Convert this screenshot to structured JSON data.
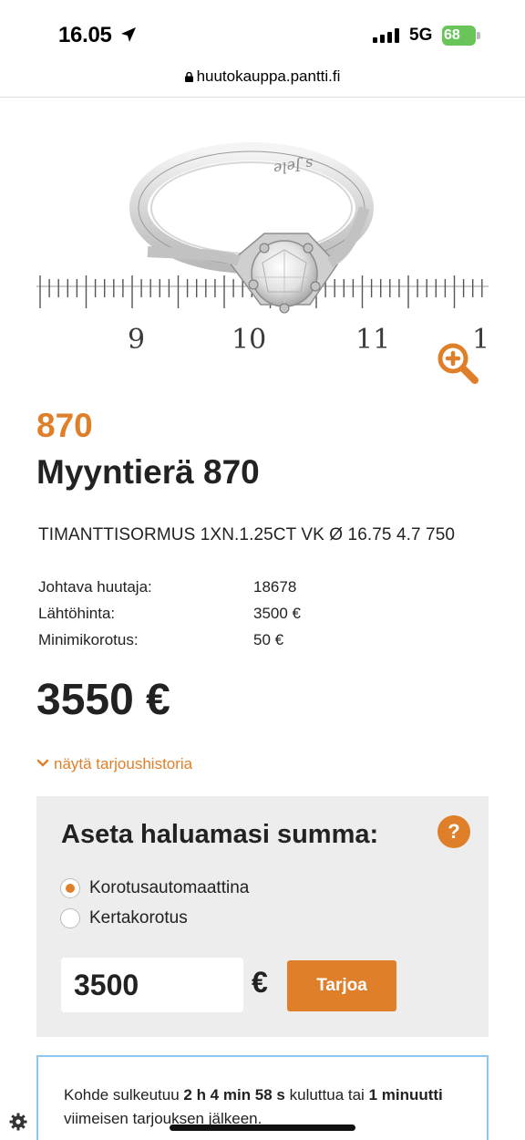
{
  "status_bar": {
    "time": "16.05",
    "network": "5G",
    "battery": "68"
  },
  "browser": {
    "url": "huutokauppa.pantti.fi"
  },
  "lot": {
    "number": "870",
    "title": "Myyntierä 870",
    "description": "TIMANTTISORMUS 1XN.1.25CT VK Ø 16.75 4.7 750",
    "ruler_labels": [
      "9",
      "10",
      "11",
      "1"
    ],
    "ring_engraving": "s Jele",
    "details": [
      {
        "label": "Johtava huutaja:",
        "value": "18678"
      },
      {
        "label": "Lähtöhinta:",
        "value": "3500 €"
      },
      {
        "label": "Minimikorotus:",
        "value": "50 €"
      }
    ],
    "current_price": "3550 €",
    "history_link": "näytä tarjoushistoria"
  },
  "bid_form": {
    "title": "Aseta haluamasi summa:",
    "help": "?",
    "options": [
      {
        "label": "Korotusautomaattina",
        "checked": true
      },
      {
        "label": "Kertakorotus",
        "checked": false
      }
    ],
    "amount": "3500",
    "currency": "€",
    "submit_label": "Tarjoa"
  },
  "closing": {
    "pre": "Kohde sulkeutuu ",
    "time_left": "2 h 4 min 58 s",
    "mid": " kuluttua tai ",
    "extension": "1 minuutti",
    "post": " viimeisen tarjouksen jälkeen."
  },
  "colors": {
    "accent": "#e07f2a",
    "panel_bg": "#ededed",
    "box_border": "#8cc8f0",
    "battery": "#69c45a"
  }
}
